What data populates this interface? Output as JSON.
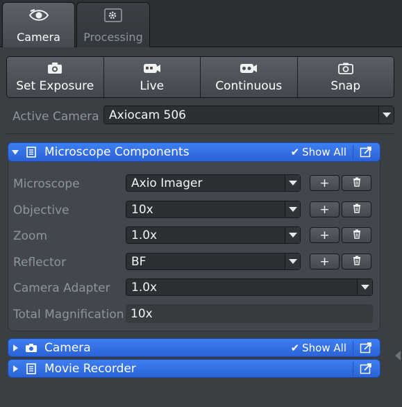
{
  "tabs": [
    {
      "label": "Camera",
      "icon": "eye-icon",
      "active": true
    },
    {
      "label": "Processing",
      "icon": "gear-icon",
      "active": false
    }
  ],
  "capture_buttons": [
    {
      "label": "Set Exposure",
      "icon": "camera-icon"
    },
    {
      "label": "Live",
      "icon": "video-camera-icon"
    },
    {
      "label": "Continuous",
      "icon": "video-tape-icon"
    },
    {
      "label": "Snap",
      "icon": "snapshot-camera-icon"
    }
  ],
  "active_camera": {
    "label": "Active Camera",
    "value": "Axiocam 506"
  },
  "sections": {
    "microscope": {
      "title": "Microscope Components",
      "show_all": "Show All",
      "expanded": true
    },
    "camera": {
      "title": "Camera",
      "show_all": "Show All",
      "expanded": false
    },
    "movie": {
      "title": "Movie Recorder",
      "expanded": false
    }
  },
  "components": [
    {
      "label": "Microscope",
      "value": "Axio Imager",
      "add": "+"
    },
    {
      "label": "Objective",
      "value": "10x",
      "add": "+"
    },
    {
      "label": "Zoom",
      "value": "1.0x",
      "add": "+"
    },
    {
      "label": "Reflector",
      "value": "BF",
      "add": "+"
    }
  ],
  "camera_adapter": {
    "label": "Camera Adapter",
    "value": "1.0x"
  },
  "total_magnification": {
    "label": "Total Magnification",
    "value": "10x"
  },
  "colors": {
    "accent": "#3a78ee",
    "panel": "#3a3f44",
    "field": "#2b3034"
  }
}
